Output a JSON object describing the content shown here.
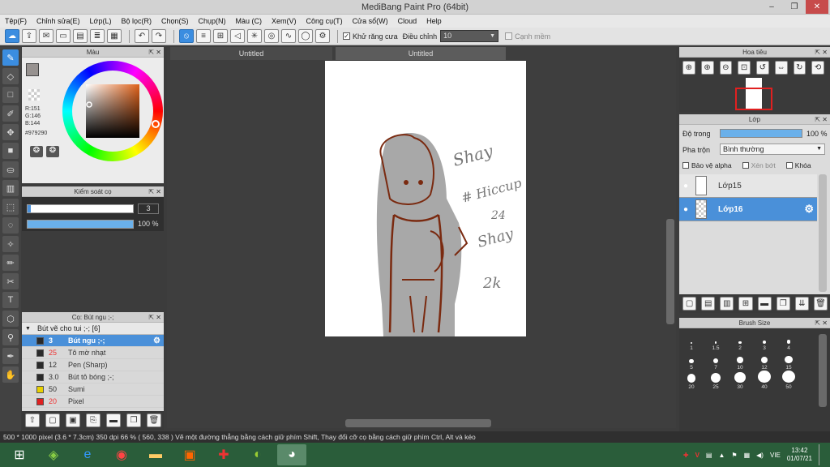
{
  "window": {
    "title": "MediBang Paint Pro (64bit)"
  },
  "menu": [
    "Tệp(F)",
    "Chỉnh sửa(E)",
    "Lớp(L)",
    "Bộ lọc(R)",
    "Chọn(S)",
    "Chụp(N)",
    "Màu (C)",
    "Xem(V)",
    "Công cụ(T)",
    "Cửa sổ(W)",
    "Cloud",
    "Help"
  ],
  "toolbar": {
    "antialias_label": "Khử răng cưa",
    "adjust_label": "Điều chỉnh",
    "adjust_value": "10",
    "soft_edge_label": "Cạnh mềm"
  },
  "tabs": [
    "Untitled",
    "Untitled"
  ],
  "color_panel": {
    "title": "Màu",
    "r": "R:151",
    "g": "G:146",
    "b": "B:144",
    "hex": "#979290",
    "current_color": "#979290"
  },
  "brush_control": {
    "title": "Kiểm soát cọ",
    "size": "3",
    "opacity": "100 %"
  },
  "brush_panel": {
    "title": "Cọ: Bút ngu ;-;",
    "group": "Bút vẽ cho tui ;-; [6]",
    "items": [
      {
        "size": "3",
        "name": "Bút ngu ;-;",
        "color": "#2a2a2a"
      },
      {
        "size": "25",
        "name": "Tô mờ nhạt",
        "color": "#2a2a2a"
      },
      {
        "size": "12",
        "name": "Pen (Sharp)",
        "color": "#2a2a2a"
      },
      {
        "size": "3.0",
        "name": "Bút tô bóng ;-;",
        "color": "#2a2a2a"
      },
      {
        "size": "50",
        "name": "Sumi",
        "color": "#e8d000"
      },
      {
        "size": "20",
        "name": "Pixel",
        "color": "#e02020"
      }
    ]
  },
  "navigator": {
    "title": "Hoa tiêu"
  },
  "layer_panel": {
    "title": "Lớp",
    "opacity_label": "Độ trong",
    "opacity_value": "100 %",
    "blend_label": "Pha trộn",
    "blend_value": "Bình thường",
    "protect_alpha": "Bảo vệ alpha",
    "clipping": "Xén bớt",
    "lock": "Khóa",
    "layers": [
      {
        "name": "Lớp15"
      },
      {
        "name": "Lớp16"
      }
    ]
  },
  "brush_size": {
    "title": "Brush Size",
    "sizes": [
      "1",
      "1.5",
      "2",
      "3",
      "4",
      "5",
      "7",
      "10",
      "12",
      "15",
      "20",
      "25",
      "30",
      "40",
      "50"
    ]
  },
  "status": "500 * 1000 pixel   (3.6 * 7.3cm)   350 dpi   66 %   ( 560, 338 )   Vẽ một đường thẳng bằng cách giữ phím Shift, Thay đổi cỡ cọ bằng cách giữ phím Ctrl, Alt và kéo",
  "taskbar": {
    "lang": "VIE",
    "time": "13:42",
    "date": "01/07/21"
  },
  "canvas_text": [
    "Shay",
    "# Hiccup",
    "24",
    "Shay",
    "2k"
  ]
}
